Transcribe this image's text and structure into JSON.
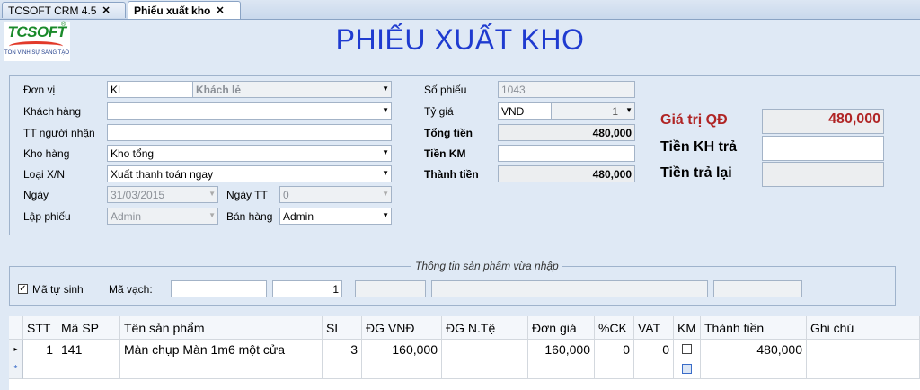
{
  "tabs": [
    {
      "label": "TCSOFT CRM 4.5",
      "close": "✕"
    },
    {
      "label": "Phiếu xuất kho",
      "close": "✕"
    }
  ],
  "logo": {
    "text": "TCSOFT",
    "tagline": "TÔN VINH SỰ SÁNG TẠO",
    "reg": "®"
  },
  "title": "PHIẾU XUẤT KHO",
  "form": {
    "don_vi": {
      "label": "Đơn vị",
      "code": "KL",
      "name": "Khách lẻ"
    },
    "khach_hang": {
      "label": "Khách hàng",
      "value": ""
    },
    "tt_nguoi_nhan": {
      "label": "TT người nhận",
      "value": ""
    },
    "kho_hang": {
      "label": "Kho hàng",
      "value": "Kho tổng"
    },
    "loai_xn": {
      "label": "Loại X/N",
      "value": "Xuất thanh toán ngay"
    },
    "ngay": {
      "label": "Ngày",
      "value": "31/03/2015"
    },
    "ngay_tt": {
      "label": "Ngày TT",
      "value": "0"
    },
    "lap_phieu": {
      "label": "Lập phiếu",
      "value": "Admin"
    },
    "ban_hang": {
      "label": "Bán hàng",
      "value": "Admin"
    },
    "so_phieu": {
      "label": "Số phiếu",
      "value": "1043"
    },
    "ty_gia": {
      "label": "Tỷ giá",
      "currency": "VND",
      "rate": "1"
    },
    "tong_tien": {
      "label": "Tổng tiền",
      "value": "480,000"
    },
    "tien_km": {
      "label": "Tiền KM",
      "value": ""
    },
    "thanh_tien": {
      "label": "Thành tiền",
      "value": "480,000"
    },
    "gia_tri_qd": {
      "label": "Giá trị QĐ",
      "value": "480,000"
    },
    "tien_kh_tra": {
      "label": "Tiền KH trả",
      "value": ""
    },
    "tien_tra_lai": {
      "label": "Tiền trả lại",
      "value": ""
    }
  },
  "product_info": {
    "legend": "Thông tin sản phẩm vừa nhập",
    "ma_tu_sinh": {
      "label": "Mã tự sinh",
      "checked": true,
      "mark": "✓"
    },
    "ma_vach": {
      "label": "Mã vạch:",
      "value": ""
    },
    "qty": "1"
  },
  "grid": {
    "columns": [
      "STT",
      "Mã SP",
      "Tên sản phẩm",
      "SL",
      "ĐG VNĐ",
      "ĐG N.Tệ",
      "Đơn giá",
      "%CK",
      "VAT",
      "KM",
      "Thành tiền",
      "Ghi chú"
    ],
    "rows": [
      {
        "stt": "1",
        "ma_sp": "141",
        "ten": "Màn chụp Màn 1m6 một cửa",
        "sl": "3",
        "dg_vnd": "160,000",
        "dg_nte": "",
        "don_gia": "160,000",
        "ck": "0",
        "vat": "0",
        "km": false,
        "thanh_tien": "480,000",
        "ghi_chu": ""
      }
    ],
    "row_marker": "▸",
    "new_row_marker": "*"
  },
  "icons": {
    "dropdown": "▼"
  },
  "colors": {
    "title": "#1f3bd0",
    "qd_label": "#b02424",
    "qd_value": "#b02424",
    "background": "#dfe9f5"
  }
}
